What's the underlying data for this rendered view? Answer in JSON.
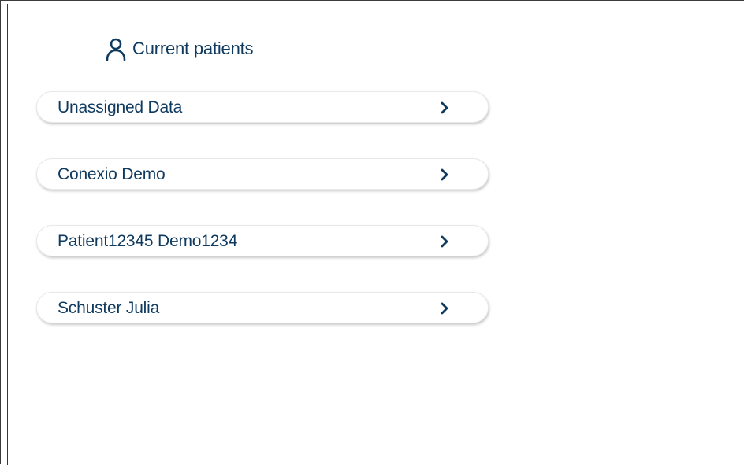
{
  "header": {
    "title": "Current patients",
    "icon": "person-icon"
  },
  "patients": [
    {
      "label": "Unassigned Data",
      "icon": "chevron-right-icon"
    },
    {
      "label": "Conexio Demo",
      "icon": "chevron-right-icon"
    },
    {
      "label": "Patient12345 Demo1234",
      "icon": "chevron-right-icon"
    },
    {
      "label": "Schuster Julia",
      "icon": "chevron-right-icon"
    }
  ],
  "colors": {
    "text": "#0f3a5f",
    "border": "#e6e8ec",
    "background": "#ffffff"
  }
}
